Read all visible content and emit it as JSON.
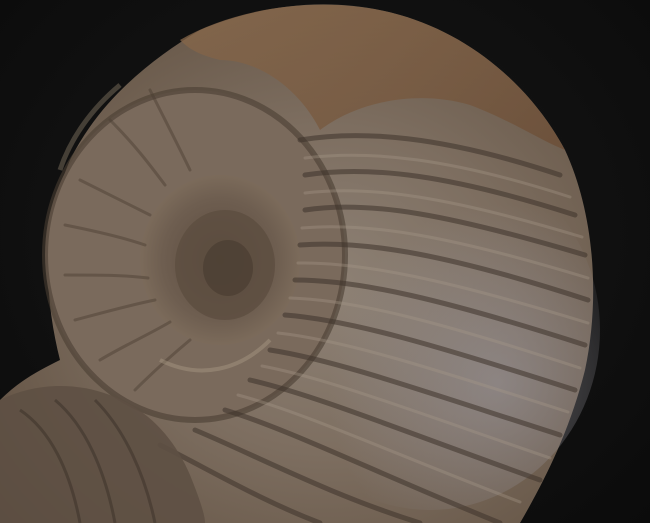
{
  "image": {
    "subject_icon": "ammonite-fossil",
    "colors": {
      "background": "#101010",
      "shell_base": "#7a6a5a",
      "shell_light": "#9a8a78",
      "shell_dark": "#4a3d32",
      "rib_shadow": "#3e332b",
      "rust": "#8a5a38",
      "blue_grey": "#8a8a90"
    }
  }
}
